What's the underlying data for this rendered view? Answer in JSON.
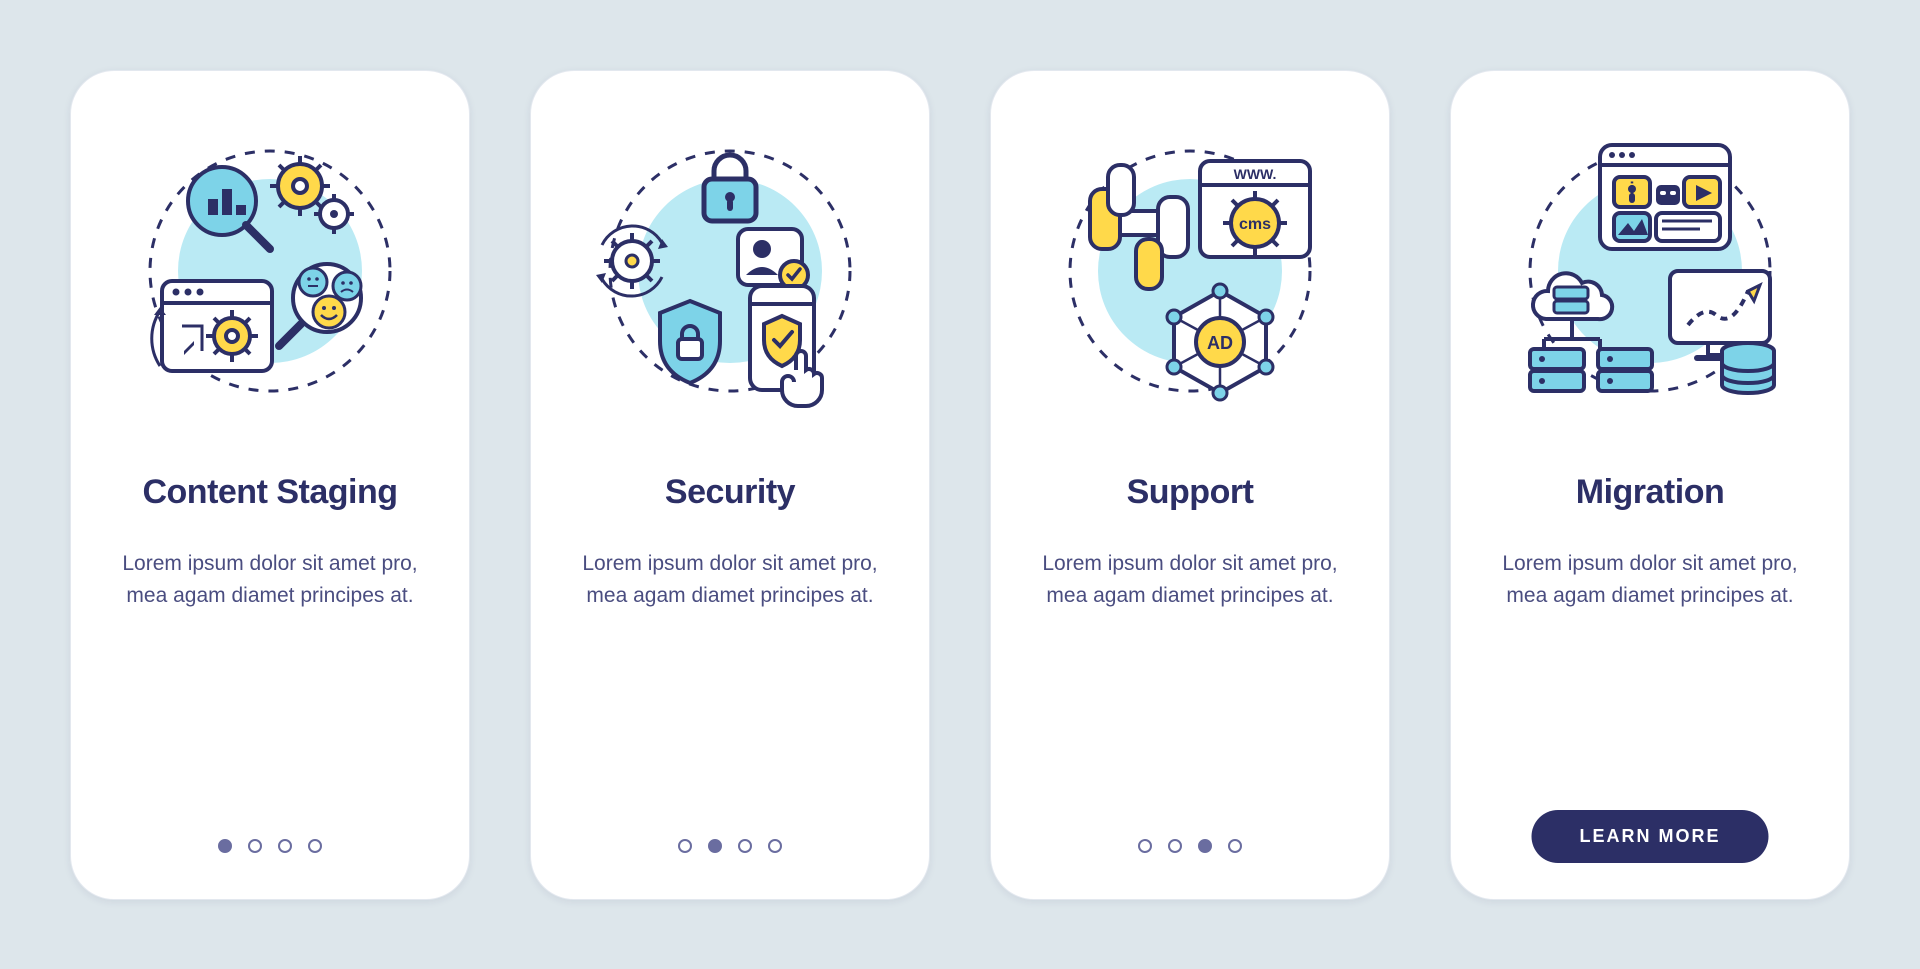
{
  "colors": {
    "background": "#dde6eb",
    "card": "#ffffff",
    "outline": "#2c2f66",
    "heading": "#2c2f66",
    "body": "#4a4d80",
    "accent_yellow": "#ffd94a",
    "accent_blue": "#7dd3e8",
    "accent_blue_light": "#baeaf4",
    "cta_bg": "#2c2f66",
    "cta_text": "#ffffff"
  },
  "common": {
    "description": "Lorem ipsum dolor sit amet pro, mea agam diamet principes at.",
    "cta_label": "LEARN MORE"
  },
  "cards": [
    {
      "id": "content-staging",
      "title": "Content Staging",
      "active_dot": 0,
      "total_dots": 4,
      "has_cta": false,
      "illustration_text": {}
    },
    {
      "id": "security",
      "title": "Security",
      "active_dot": 1,
      "total_dots": 4,
      "has_cta": false,
      "illustration_text": {}
    },
    {
      "id": "support",
      "title": "Support",
      "active_dot": 2,
      "total_dots": 4,
      "has_cta": false,
      "illustration_text": {
        "www_label": "WWW.",
        "cms_label": "cms",
        "ad_label": "AD"
      }
    },
    {
      "id": "migration",
      "title": "Migration",
      "active_dot": 3,
      "total_dots": 4,
      "has_cta": true,
      "illustration_text": {
        "info_label": "i"
      }
    }
  ]
}
